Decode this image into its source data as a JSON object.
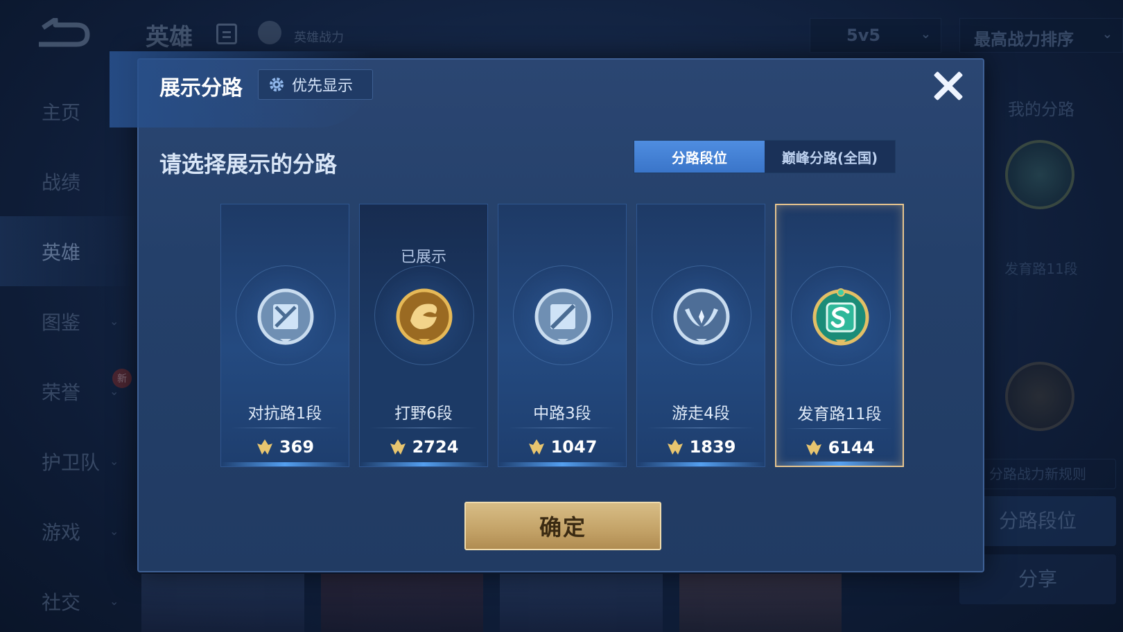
{
  "background": {
    "title": "英雄",
    "hero_power_label": "英雄战力",
    "mode_select": "5v5",
    "sort_select": "最高战力排序",
    "nav": [
      {
        "label": "主页",
        "has_chevron": false
      },
      {
        "label": "战绩",
        "has_chevron": false
      },
      {
        "label": "英雄",
        "has_chevron": false,
        "active": true
      },
      {
        "label": "图鉴",
        "has_chevron": true
      },
      {
        "label": "荣誉",
        "has_chevron": true,
        "badge": "新"
      },
      {
        "label": "护卫队",
        "has_chevron": true
      },
      {
        "label": "游戏",
        "has_chevron": true
      },
      {
        "label": "社交",
        "has_chevron": true
      }
    ],
    "right_panel": {
      "my_lane_title": "我的分路",
      "lane_label": "发育路11段",
      "rules_link": "分路战力新规则",
      "lane_rank_button": "分路段位",
      "share_button": "分享"
    }
  },
  "modal": {
    "title": "展示分路",
    "priority_button": "优先显示",
    "prompt": "请选择展示的分路",
    "tabs": [
      {
        "label": "分路段位",
        "active": true
      },
      {
        "label": "巅峰分路(全国)",
        "active": false
      }
    ],
    "cards": [
      {
        "name": "对抗路1段",
        "score": "369",
        "badge_icon": "clash-lane-badge-icon",
        "badge_color": "#9fc3e8",
        "displayed": false,
        "selected": false
      },
      {
        "name": "打野6段",
        "score": "2724",
        "badge_icon": "jungle-dragon-badge-icon",
        "badge_color": "#d7a24a",
        "displayed": true,
        "displayed_label": "已展示",
        "selected": false
      },
      {
        "name": "中路3段",
        "score": "1047",
        "badge_icon": "mid-lane-badge-icon",
        "badge_color": "#9fc3e8",
        "displayed": false,
        "selected": false
      },
      {
        "name": "游走4段",
        "score": "1839",
        "badge_icon": "roam-wings-badge-icon",
        "badge_color": "#9fc3e8",
        "displayed": false,
        "selected": false
      },
      {
        "name": "发育路11段",
        "score": "6144",
        "badge_icon": "farm-lane-badge-icon",
        "badge_color": "#2fb89a",
        "displayed": false,
        "selected": true
      }
    ],
    "confirm_button": "确定"
  },
  "colors": {
    "accent_gold": "#e7c58f",
    "tab_active": "#4f8de0",
    "modal_bg": "#24406a"
  }
}
